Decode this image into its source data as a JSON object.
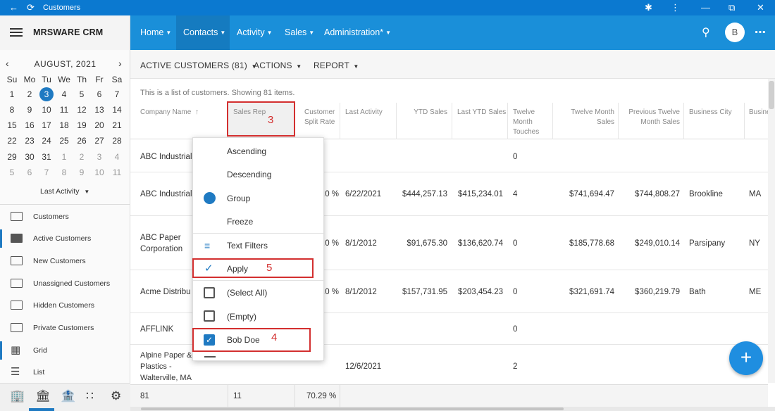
{
  "window": {
    "title": "Customers"
  },
  "app": {
    "brand": "MRSWARE CRM",
    "avatar_letter": "B"
  },
  "nav": {
    "items": [
      {
        "label": "Home"
      },
      {
        "label": "Contacts"
      },
      {
        "label": "Activity"
      },
      {
        "label": "Sales"
      },
      {
        "label": "Administration*"
      }
    ]
  },
  "calendar": {
    "month_label": "AUGUST, 2021",
    "day_names": [
      "Su",
      "Mo",
      "Tu",
      "We",
      "Th",
      "Fr",
      "Sa"
    ],
    "weeks": [
      [
        "1",
        "2",
        "3",
        "4",
        "5",
        "6",
        "7"
      ],
      [
        "8",
        "9",
        "10",
        "11",
        "12",
        "13",
        "14"
      ],
      [
        "15",
        "16",
        "17",
        "18",
        "19",
        "20",
        "21"
      ],
      [
        "22",
        "23",
        "24",
        "25",
        "26",
        "27",
        "28"
      ],
      [
        "29",
        "30",
        "31",
        "1",
        "2",
        "3",
        "4"
      ],
      [
        "5",
        "6",
        "7",
        "8",
        "9",
        "10",
        "11"
      ]
    ],
    "selected_day": "3",
    "filter_label": "Last Activity"
  },
  "sidebar": {
    "items": [
      {
        "label": "Customers"
      },
      {
        "label": "Active Customers"
      },
      {
        "label": "New Customers"
      },
      {
        "label": "Unassigned Customers"
      },
      {
        "label": "Hidden Customers"
      },
      {
        "label": "Private Customers"
      },
      {
        "label": "Grid"
      },
      {
        "label": "List"
      }
    ]
  },
  "toolbar": {
    "view_label": "ACTIVE CUSTOMERS (81)",
    "actions_label": "ACTIONS",
    "report_label": "REPORT"
  },
  "info_text": "This is a list of customers. Showing 81 items.",
  "grid": {
    "columns": [
      "Company Name",
      "Sales Rep",
      "Customer Split Rate",
      "Last Activity",
      "YTD Sales",
      "Last YTD Sales",
      "Twelve Month Touches",
      "Twelve Month Sales",
      "Previous Twelve Month Sales",
      "Business City",
      "Busine"
    ],
    "rows": [
      {
        "company": "ABC Industrial",
        "split": "",
        "last_activity": "",
        "ytd": "",
        "last_ytd": "",
        "touches": "0",
        "twelve": "",
        "prev_twelve": "",
        "city": "",
        "state": ""
      },
      {
        "company": "ABC Industrial",
        "split": ".0 %",
        "last_activity": "6/22/2021",
        "ytd": "$444,257.13",
        "last_ytd": "$415,234.01",
        "touches": "4",
        "twelve": "$741,694.47",
        "prev_twelve": "$744,808.27",
        "city": "Brookline",
        "state": "MA"
      },
      {
        "company": "ABC Paper Corporation",
        "split": ".0 %",
        "last_activity": "8/1/2012",
        "ytd": "$91,675.30",
        "last_ytd": "$136,620.74",
        "touches": "0",
        "twelve": "$185,778.68",
        "prev_twelve": "$249,010.14",
        "city": "Parsipany",
        "state": "NY"
      },
      {
        "company": "Acme Distribu",
        "split": ".0 %",
        "last_activity": "8/1/2012",
        "ytd": "$157,731.95",
        "last_ytd": "$203,454.23",
        "touches": "0",
        "twelve": "$321,691.74",
        "prev_twelve": "$360,219.79",
        "city": "Bath",
        "state": "ME"
      },
      {
        "company": "AFFLINK",
        "split": "",
        "last_activity": "",
        "ytd": "",
        "last_ytd": "",
        "touches": "0",
        "twelve": "",
        "prev_twelve": "",
        "city": "",
        "state": ""
      },
      {
        "company": "Alpine Paper & Plastics - Walterville, MA",
        "split": "",
        "last_activity": "12/6/2021",
        "ytd": "",
        "last_ytd": "",
        "touches": "2",
        "twelve": "",
        "prev_twelve": "",
        "city": "",
        "state": ""
      }
    ],
    "footer": {
      "count": "81",
      "sales_rep": "11",
      "split": "70.29 %"
    }
  },
  "column_menu": {
    "sort_ascending": "Ascending",
    "sort_descending": "Descending",
    "group": "Group",
    "freeze": "Freeze",
    "text_filters": "Text Filters",
    "apply": "Apply",
    "select_all": "(Select All)",
    "empty": "(Empty)",
    "bob_doe": "Bob Doe"
  },
  "annotations": {
    "step3": "3",
    "step4": "4",
    "step5": "5"
  },
  "colors": {
    "title_bar": "#0b79d0",
    "nav_bar": "#1a8fd9",
    "accent": "#1f7ac2",
    "annotation": "#d32f2f"
  }
}
